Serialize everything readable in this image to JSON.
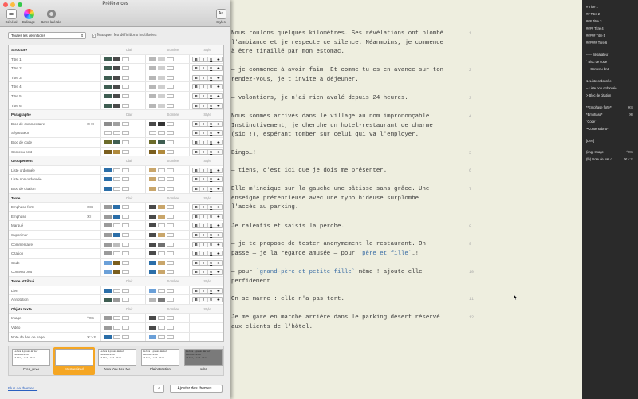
{
  "window": {
    "title": "Préférences"
  },
  "toolbar": {
    "general": "Général",
    "markup": "Balisage",
    "sidebar": "Barre latérale",
    "styles": "Styles"
  },
  "filter": {
    "selected": "Toutes les définitions",
    "hide_unused": "Masquer les définitions inutilisées",
    "hide_checked": "✓"
  },
  "columns": {
    "light": "Clair",
    "dark": "Sombre",
    "style": "Style"
  },
  "style_buttons": [
    "B",
    "I",
    "U",
    "S"
  ],
  "rows": [
    {
      "label": "Structure",
      "group": true
    },
    {
      "label": "Titre 1",
      "key": "",
      "l": [
        "#3f5e52",
        "#4a4a4a"
      ],
      "d": [
        "#b7b7b7",
        "#cfcfcf"
      ],
      "s": true
    },
    {
      "label": "Titre 2",
      "key": "",
      "l": [
        "#3f5e52",
        "#4a4a4a"
      ],
      "d": [
        "#b7b7b7",
        "#cfcfcf"
      ],
      "s": true
    },
    {
      "label": "Titre 3",
      "key": "",
      "l": [
        "#3f5e52",
        "#4a4a4a"
      ],
      "d": [
        "#b7b7b7",
        "#cfcfcf"
      ],
      "s": true
    },
    {
      "label": "Titre 4",
      "key": "",
      "l": [
        "#3f5e52",
        "#4a4a4a"
      ],
      "d": [
        "#b7b7b7",
        "#cfcfcf"
      ],
      "s": true
    },
    {
      "label": "Titre 5",
      "key": "",
      "l": [
        "#3f5e52",
        "#4a4a4a"
      ],
      "d": [
        "#b7b7b7",
        "#cfcfcf"
      ],
      "s": true
    },
    {
      "label": "Titre 6",
      "key": "",
      "l": [
        "#3f5e52",
        "#4a4a4a"
      ],
      "d": [
        "#b7b7b7",
        "#cfcfcf"
      ],
      "s": true
    },
    {
      "label": "Paragraphe",
      "group": true
    },
    {
      "label": "Bloc de commentaire",
      "key": "⌘⇧I",
      "l": [
        "#8c8c8c",
        "#a0a0a0"
      ],
      "d": [
        "#4a4a4a",
        "#333333"
      ],
      "s": true
    },
    {
      "label": "Séparateur",
      "key": "",
      "l": [
        "",
        ""
      ],
      "d": [
        "",
        ""
      ],
      "s": true
    },
    {
      "label": "Bloc de code",
      "key": "",
      "l": [
        "#6b6b2a",
        "#3f5e52"
      ],
      "d": [
        "#6b6b2a",
        "#3f5e52"
      ],
      "s": true
    },
    {
      "label": "Contenu brut",
      "key": "",
      "l": [
        "#7a5e1e",
        "#b08a3c"
      ],
      "d": [
        "#7a5e1e",
        "#b08a3c"
      ],
      "s": true
    },
    {
      "label": "Groupement",
      "group": true
    },
    {
      "label": "Liste ordonnée",
      "key": "",
      "l": [
        "#2b6ea8",
        ""
      ],
      "d": [
        "#c9a66b",
        ""
      ],
      "s": true
    },
    {
      "label": "Liste non ordonnée",
      "key": "",
      "l": [
        "#2b6ea8",
        ""
      ],
      "d": [
        "#c9a66b",
        ""
      ],
      "s": true
    },
    {
      "label": "Bloc de citation",
      "key": "",
      "l": [
        "#2b6ea8",
        ""
      ],
      "d": [
        "#c9a66b",
        ""
      ],
      "s": true
    },
    {
      "label": "Texte",
      "group": true
    },
    {
      "label": "Emphase forte",
      "key": "⌘B",
      "l": [
        "#9a9a9a",
        "#2b6ea8"
      ],
      "d": [
        "#4a4a4a",
        "#c9a66b"
      ],
      "s": true
    },
    {
      "label": "Emphase",
      "key": "⌘I",
      "l": [
        "#9a9a9a",
        "#2b6ea8"
      ],
      "d": [
        "#4a4a4a",
        "#c9a66b"
      ],
      "s": true
    },
    {
      "label": "Marqué",
      "key": "",
      "l": [
        "#9a9a9a",
        ""
      ],
      "d": [
        "#4a4a4a",
        ""
      ],
      "s": true
    },
    {
      "label": "Supprimer",
      "key": "",
      "l": [
        "#9a9a9a",
        "#2b6ea8"
      ],
      "d": [
        "#4a4a4a",
        "#c9a66b"
      ],
      "s": true
    },
    {
      "label": "Commentaire",
      "key": "",
      "l": [
        "#9a9a9a",
        "#bcbcbc"
      ],
      "d": [
        "#4a4a4a",
        "#707070"
      ],
      "s": true
    },
    {
      "label": "Citation",
      "key": "",
      "l": [
        "#9a9a9a",
        ""
      ],
      "d": [
        "#4a4a4a",
        ""
      ],
      "s": true
    },
    {
      "label": "Code",
      "key": "",
      "l": [
        "#6ba0d8",
        "#7a5e1e"
      ],
      "d": [
        "#2b6ea8",
        "#c9a66b"
      ],
      "s": true
    },
    {
      "label": "Contenu brut",
      "key": "",
      "l": [
        "#6ba0d8",
        "#7a5e1e"
      ],
      "d": [
        "#2b6ea8",
        "#c9a66b"
      ],
      "s": true
    },
    {
      "label": "Texte attribué",
      "group": true
    },
    {
      "label": "Lien",
      "key": "",
      "l": [
        "#2b6ea8",
        ""
      ],
      "d": [
        "#6ba0d8",
        ""
      ],
      "s": true
    },
    {
      "label": "Annotation",
      "key": "",
      "l": [
        "#3f5e52",
        "#9a9a9a"
      ],
      "d": [
        "#b7b7b7",
        "#7a7a7a"
      ],
      "s": true
    },
    {
      "label": "Objets texte",
      "group": true
    },
    {
      "label": "Image",
      "key": "^⌘K",
      "l": [
        "#9a9a9a",
        ""
      ],
      "d": [
        "#4a4a4a",
        ""
      ],
      "s": false
    },
    {
      "label": "Vidéo",
      "key": "",
      "l": [
        "#9a9a9a",
        ""
      ],
      "d": [
        "#4a4a4a",
        ""
      ],
      "s": false
    },
    {
      "label": "Note de bas de page",
      "key": "⌘⌥E",
      "l": [
        "#2b6ea8",
        ""
      ],
      "d": [
        "#6ba0d8",
        ""
      ],
      "s": false
    }
  ],
  "themes": [
    {
      "name": "Free_revu",
      "selected": false,
      "bg": "#ffffff"
    },
    {
      "name": "Mustardized",
      "selected": true,
      "bg": "#ffffff"
    },
    {
      "name": "Now You See Me",
      "selected": false,
      "bg": "#ffffff"
    },
    {
      "name": "Plainstraction",
      "selected": false,
      "bg": "#ffffff"
    },
    {
      "name": "sobr",
      "selected": false,
      "bg": "#7a7a7a"
    }
  ],
  "theme_preview": [
    "Lorem ipsum dolor",
    "consectetur",
    "elitr, sed diam"
  ],
  "footer": {
    "more_link": "Plus de thèmes...",
    "share": "↗",
    "add": "Ajouter des thèmes..."
  },
  "editor": {
    "paragraphs": [
      {
        "text": "Nous roulons quelques kilomètres. Ses révélations ont plombé l'ambiance et je respecte ce silence. Néanmoins, je commence à être tiraillé par mon estomac.",
        "num": "1"
      },
      {
        "text": "— je commence à avoir faim. Et comme tu es en avance sur ton rendez-vous, je t'invite à déjeuner.",
        "num": "2"
      },
      {
        "text": "— volontiers, je n'ai rien avalé depuis 24 heures.",
        "num": "3"
      },
      {
        "text": "Nous sommes arrivés dans le village au nom imprononçable. Instinctivement, je cherche un hotel-restaurant de charme (sic !), espérant tomber sur celui qui va l'employer.",
        "num": "4"
      },
      {
        "text": "Bingo…!",
        "num": "5"
      },
      {
        "text": "— tiens, c'est ici que je dois me présenter.",
        "num": "6"
      },
      {
        "text": "Elle m'indique sur la gauche une bâtisse sans grâce. Une enseigne prétentieuse avec une typo hideuse surplombe l'accès au parking.",
        "num": "7"
      },
      {
        "text": "Je ralentis et saisis la perche.",
        "num": "8"
      },
      {
        "text": "— je te propose de tester anonymement le restaurant. On passe — je la regarde amusée — pour ",
        "code": "`père et fille`",
        "tail": "…!",
        "num": "9"
      },
      {
        "text": "— pour ",
        "code": "`grand-père et petite fille`",
        "tail": " même ! ajoute elle perfidement",
        "num": "10"
      },
      {
        "text": "On se marre : elle n'a pas tort.",
        "num": "11"
      },
      {
        "text": "Je me gare en marche arrière dans le parking désert réservé aux clients de l'hôtel.",
        "num": "12"
      }
    ]
  },
  "sidebar": {
    "items": [
      {
        "label": "# Titre 1",
        "key": ""
      },
      {
        "label": "## Titre 2",
        "key": ""
      },
      {
        "label": "### Titre 3",
        "key": ""
      },
      {
        "label": "#### Titre 4",
        "key": ""
      },
      {
        "label": "##### Titre 5",
        "key": ""
      },
      {
        "label": "###### Titre 6",
        "key": ""
      },
      {
        "label": "----- Séparateur",
        "key": ""
      },
      {
        "label": "` Bloc de code",
        "key": ""
      },
      {
        "label": "— Contenu brut",
        "key": ""
      },
      {
        "label": "1. Liste ordonnée",
        "key": ""
      },
      {
        "label": "– Liste non ordonnée",
        "key": ""
      },
      {
        "label": "> Bloc de citation",
        "key": ""
      },
      {
        "label": "**Emphase forte**",
        "key": "⌘B"
      },
      {
        "label": "*Emphase*",
        "key": "⌘I"
      },
      {
        "label": "`Code`",
        "key": ""
      },
      {
        "label": "~Contenu brut~",
        "key": ""
      },
      {
        "label": "[Lien]",
        "key": ""
      },
      {
        "label": "(img) Image",
        "key": "^⌘K"
      },
      {
        "label": "(fn) Note de bas d…",
        "key": "⌘⌥E"
      }
    ]
  },
  "colors": {
    "close": "#fc605c",
    "min": "#fdbc40",
    "max": "#34c84a",
    "accent": "#f5a623"
  }
}
